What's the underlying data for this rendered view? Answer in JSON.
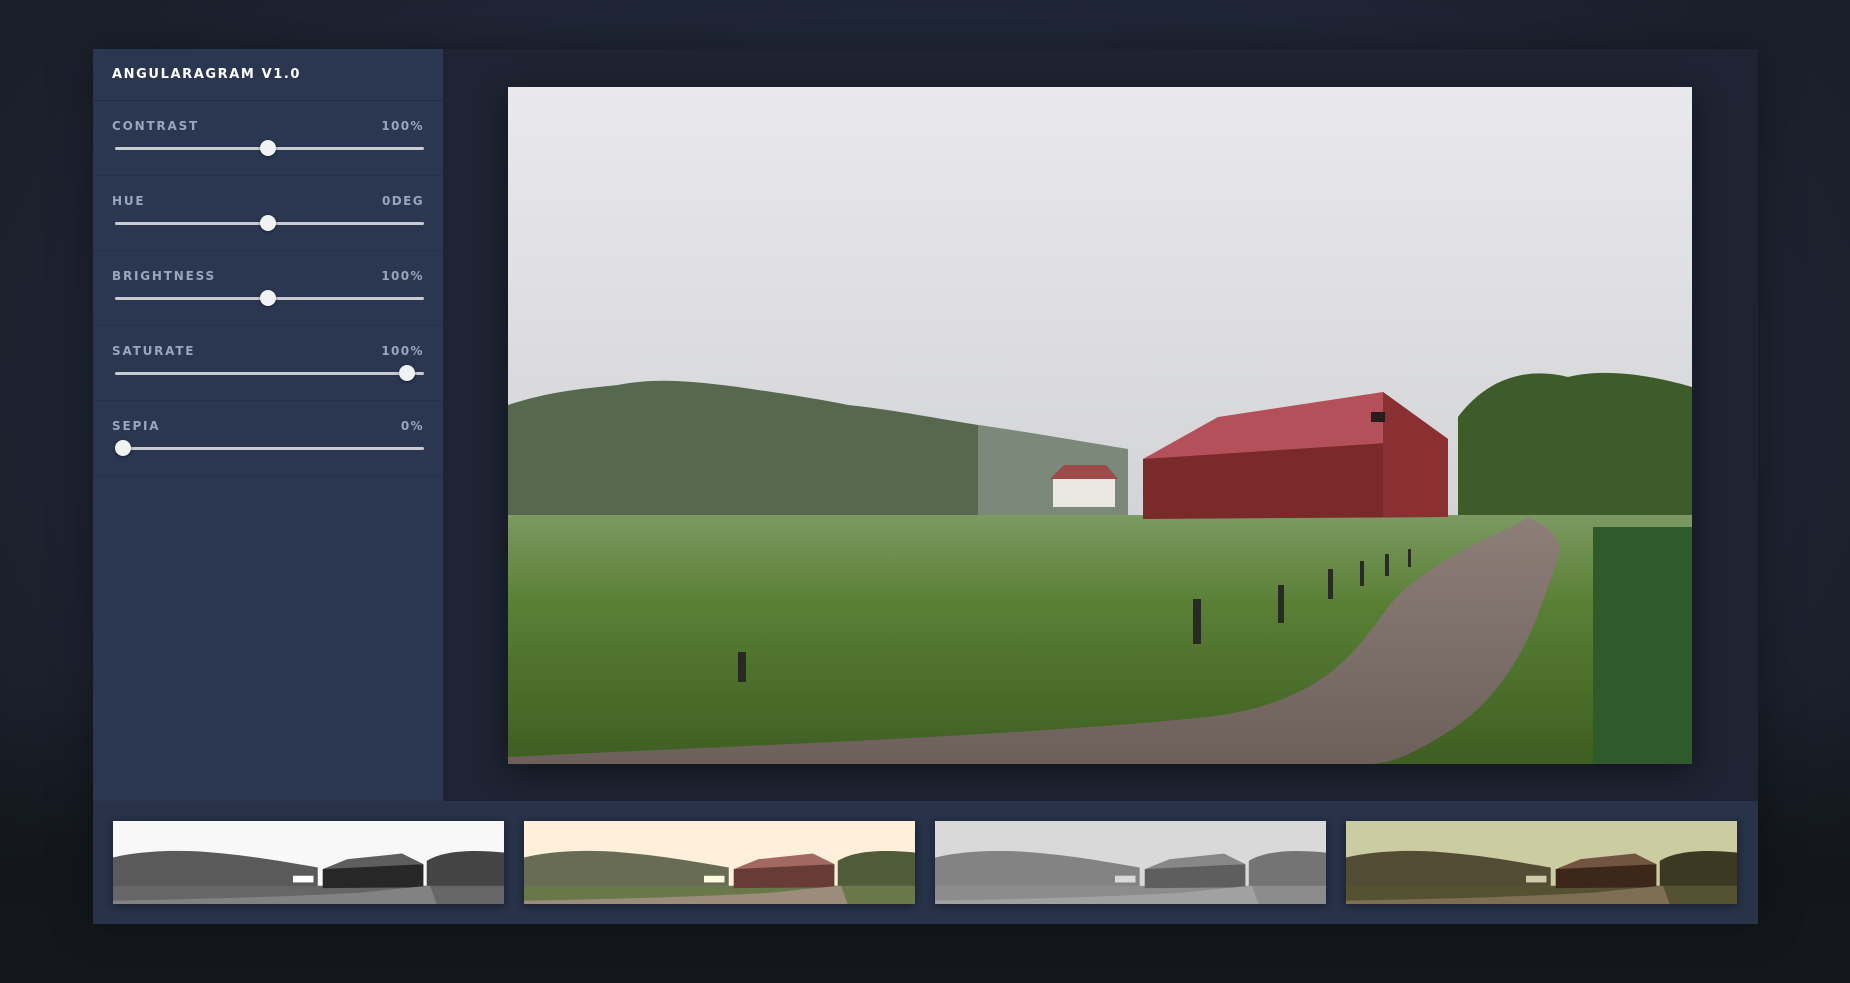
{
  "app": {
    "title": "ANGULARAGRAM V1.0"
  },
  "controls": [
    {
      "label": "CONTRAST",
      "value": "100%",
      "level": 0.5
    },
    {
      "label": "HUE",
      "value": "0DEG",
      "level": 0.5
    },
    {
      "label": "BRIGHTNESS",
      "value": "100%",
      "level": 0.5
    },
    {
      "label": "SATURATE",
      "value": "100%",
      "level": 0.98
    },
    {
      "label": "SEPIA",
      "value": "0%",
      "level": 0.0
    }
  ],
  "preview": {
    "icon": "barn-landscape-photo"
  },
  "thumbnails": [
    {
      "icon": "grayscale-filter-thumbnail",
      "filter": "grayscale(1) contrast(1.3)"
    },
    {
      "icon": "sepia-tint-filter-thumbnail",
      "filter": "sepia(0.45) saturate(0.9)"
    },
    {
      "icon": "faded-light-filter-thumbnail",
      "filter": "grayscale(1) brightness(1.35) contrast(0.7)"
    },
    {
      "icon": "dark-sepia-filter-thumbnail",
      "filter": "sepia(0.8) brightness(0.75) contrast(1.2)"
    }
  ],
  "colors": {
    "background": "#1f2535",
    "sidebar": "#2b3650",
    "thumbstrip": "#283248",
    "barn": "#7b2a2c",
    "roof": "#b4505a",
    "grass": "#4f7a30"
  }
}
